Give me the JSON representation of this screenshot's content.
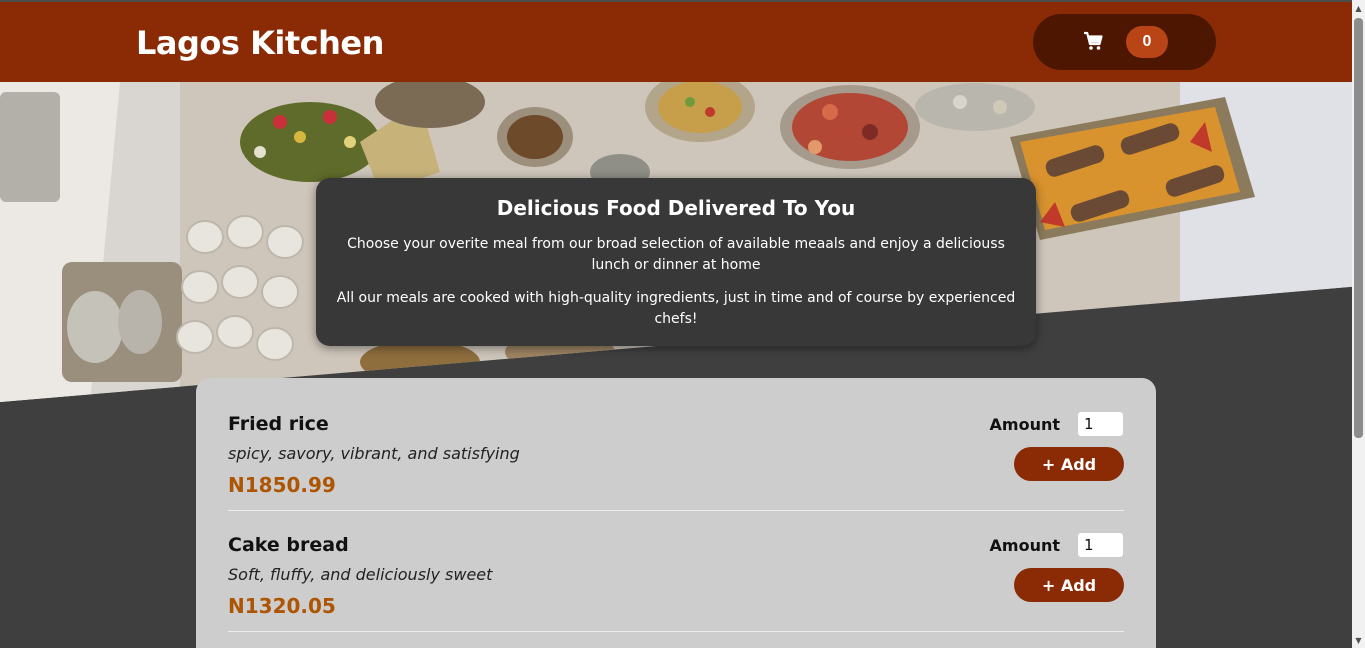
{
  "header": {
    "brand": "Lagos Kitchen",
    "cart_icon": "cart-icon",
    "cart_count": "0"
  },
  "hero": {
    "image": "buffet-table-photo"
  },
  "summary": {
    "title": "Delicious Food Delivered To You",
    "paragraph_1": "Choose your overite meal from our broad selection of available meaals and enjoy a deliciouss lunch or dinner at home",
    "paragraph_2": "All our meals are cooked with high-quality ingredients, just in time and of course by experienced chefs!"
  },
  "meals": [
    {
      "name": "Fried rice",
      "description": "spicy, savory, vibrant, and satisfying",
      "price": "N1850.99",
      "amount_label": "Amount",
      "amount_value": "1",
      "add_label": "+ Add"
    },
    {
      "name": "Cake bread",
      "description": "Soft, fluffy, and deliciously sweet",
      "price": "N1320.05",
      "amount_label": "Amount",
      "amount_value": "1",
      "add_label": "+ Add"
    }
  ],
  "colors": {
    "header": "#8a2b06",
    "cart_button": "#4d1601",
    "badge": "#b94517",
    "page_background": "#3f3f3f",
    "card": "#383838",
    "meals_background": "#cdcdcd",
    "price": "#ad5502",
    "add_button": "#8a2b06"
  }
}
